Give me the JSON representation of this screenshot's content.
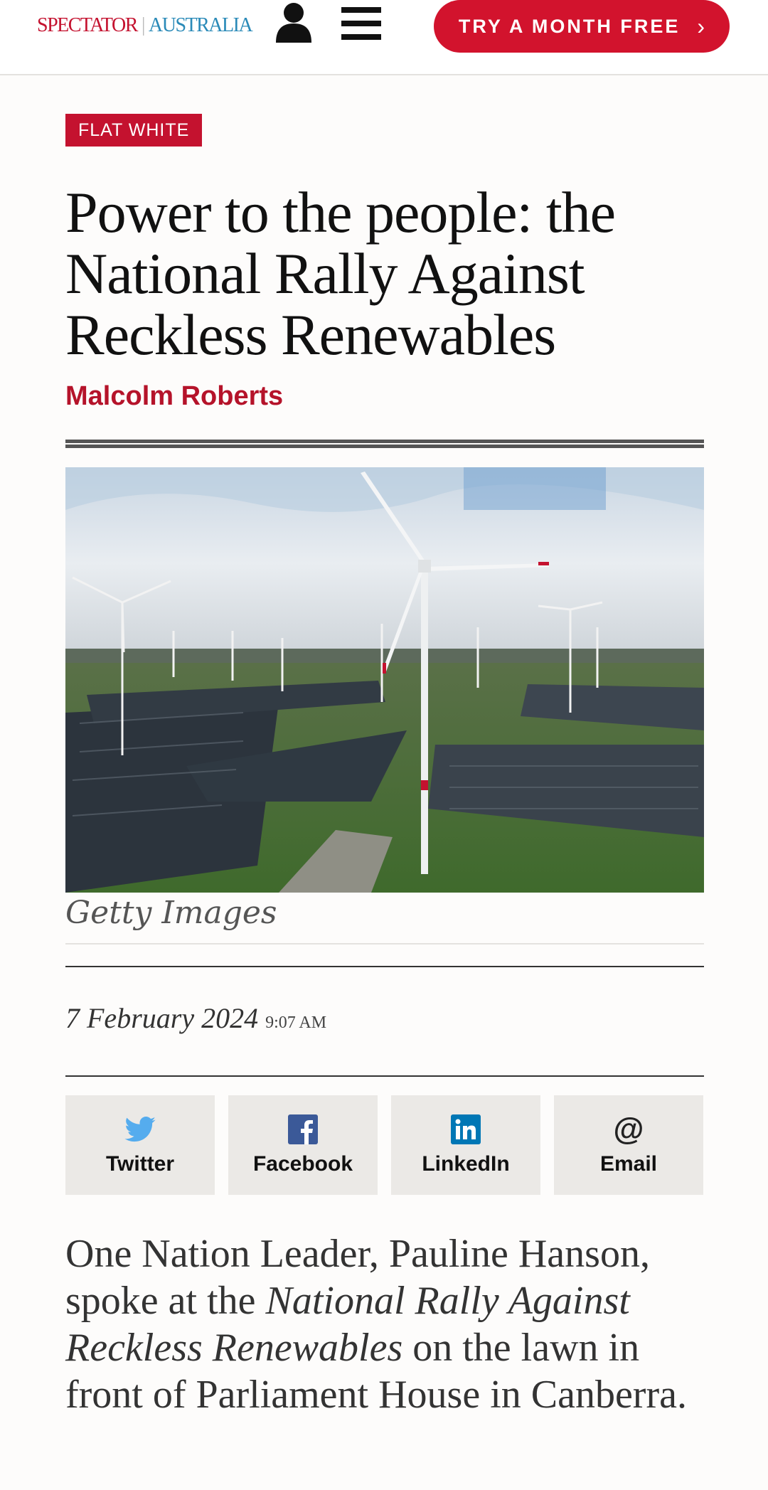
{
  "header": {
    "brand_spectator": "SPECTATOR",
    "brand_australia": "AUSTRALIA",
    "cta_label": "TRY A MONTH FREE",
    "cta_chevron": "›",
    "icons": [
      "user-icon",
      "hamburger-menu-icon",
      "chevron-right-icon"
    ],
    "accent_color": "#d2132d"
  },
  "article": {
    "section_tag": "FLAT WHITE",
    "title": "Power to the people: the National Rally Against Reckless Renewables",
    "author": "Malcolm Roberts",
    "image_caption": "Getty Images",
    "date": "7 February 2024",
    "time": "9:07 AM",
    "body": {
      "part1": "One Nation Leader, Pauline Hanson, spoke at the ",
      "part2_italic": "National Rally Against Reckless Renewables",
      "part3": " on the lawn in front of Parliament House in Canberra."
    }
  },
  "share": [
    {
      "label": "Twitter",
      "icon": "twitter-icon",
      "color": "#55acee"
    },
    {
      "label": "Facebook",
      "icon": "facebook-icon",
      "color": "#3b5998"
    },
    {
      "label": "LinkedIn",
      "icon": "linkedin-icon",
      "color": "#0077b5"
    },
    {
      "label": "Email",
      "icon": "at-sign-icon",
      "color": "#222222"
    }
  ]
}
